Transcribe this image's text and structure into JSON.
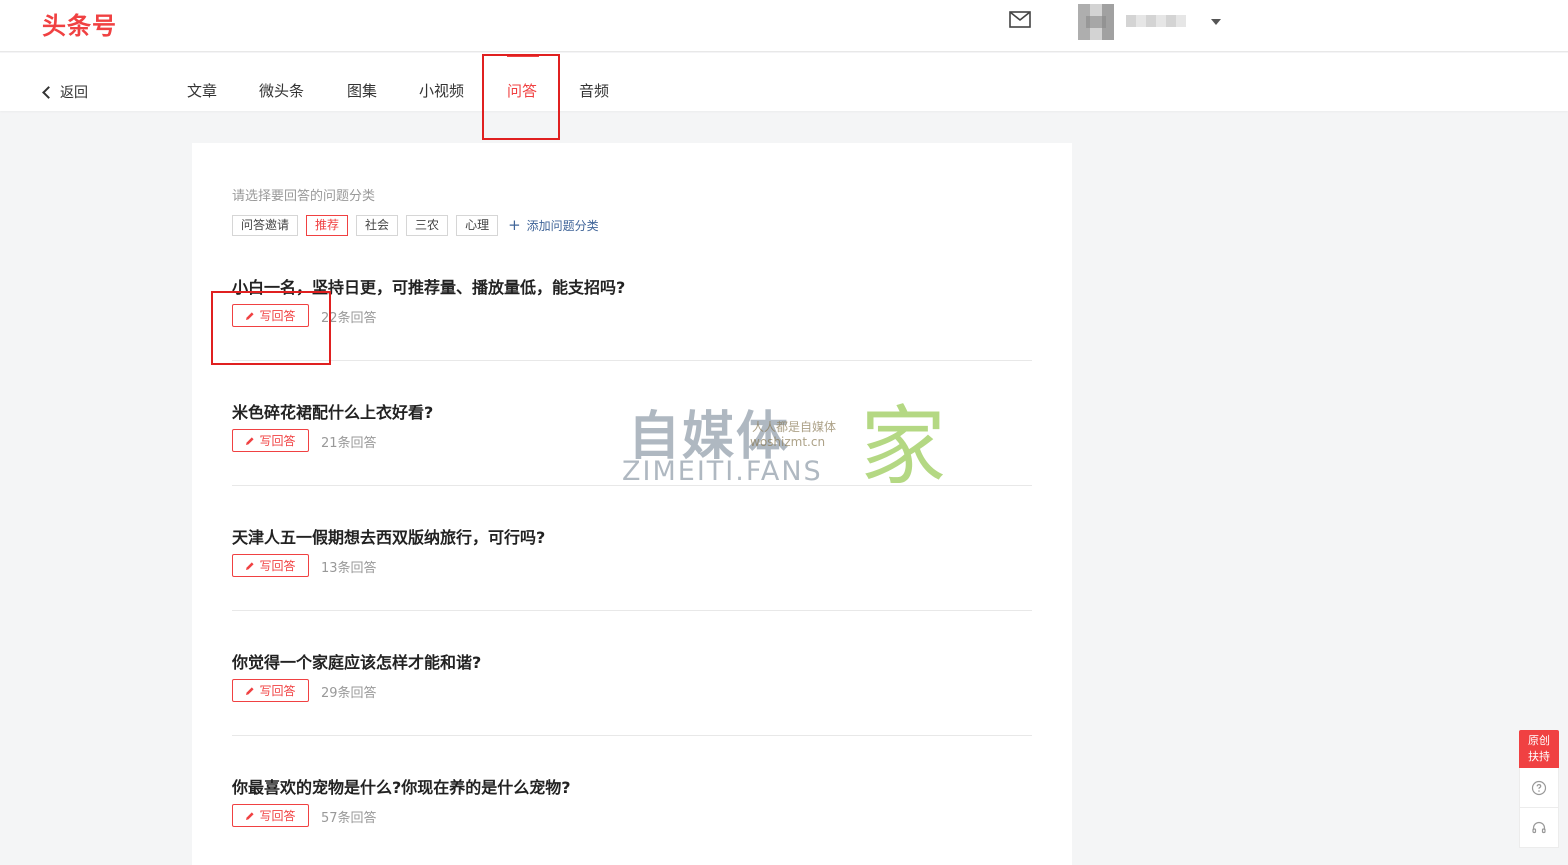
{
  "header": {
    "logo": "头条号"
  },
  "nav": {
    "back_label": "返回",
    "tabs": [
      {
        "label": "文章",
        "active": false
      },
      {
        "label": "微头条",
        "active": false
      },
      {
        "label": "图集",
        "active": false
      },
      {
        "label": "小视频",
        "active": false
      },
      {
        "label": "问答",
        "active": true
      },
      {
        "label": "音频",
        "active": false
      }
    ]
  },
  "main": {
    "prompt": "请选择要回答的问题分类",
    "categories": [
      {
        "label": "问答邀请",
        "active": false
      },
      {
        "label": "推荐",
        "active": true
      },
      {
        "label": "社会",
        "active": false
      },
      {
        "label": "三农",
        "active": false
      },
      {
        "label": "心理",
        "active": false
      }
    ],
    "add_category_label": "添加问题分类",
    "answer_button_label": "写回答",
    "questions": [
      {
        "title": "小白一名，坚持日更，可推荐量、播放量低，能支招吗?",
        "count": "22条回答"
      },
      {
        "title": "米色碎花裙配什么上衣好看?",
        "count": "21条回答"
      },
      {
        "title": "天津人五一假期想去西双版纳旅行，可行吗?",
        "count": "13条回答"
      },
      {
        "title": "你觉得一个家庭应该怎样才能和谐?",
        "count": "29条回答"
      },
      {
        "title": "你最喜欢的宠物是什么?你现在养的是什么宠物?",
        "count": "57条回答"
      }
    ]
  },
  "watermark": {
    "main": "自媒体",
    "suffix": "家",
    "latin": "ZIMEITI.FANS",
    "small_line1": "人人都是自媒体",
    "small_line2": "woshizmt.cn"
  },
  "side": {
    "original_support_line1": "原创",
    "original_support_line2": "扶持"
  },
  "colors": {
    "brand": "#f04142",
    "highlight_box": "#e02020",
    "link": "#406599"
  }
}
